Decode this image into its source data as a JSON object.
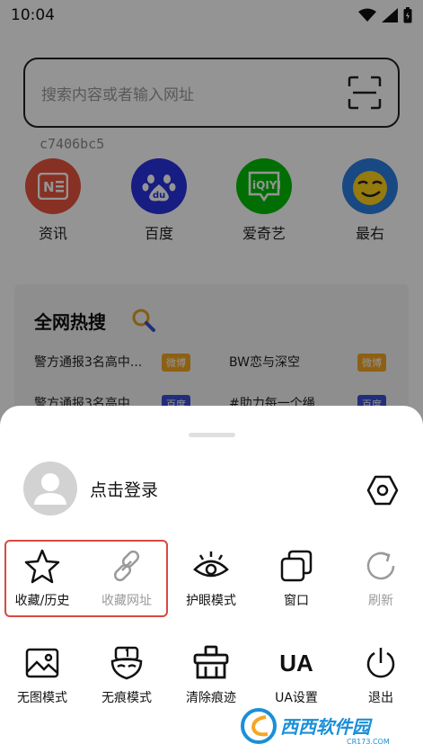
{
  "status_bar": {
    "time": "10:04"
  },
  "search": {
    "placeholder": "搜索内容或者输入网址"
  },
  "device_id": "c7406bc5",
  "shortcuts": [
    {
      "label": "资讯",
      "icon": "news-icon",
      "color": "#e8533e"
    },
    {
      "label": "百度",
      "icon": "baidu-icon",
      "color": "#2932e1"
    },
    {
      "label": "爱奇艺",
      "icon": "iqiyi-icon",
      "color": "#00be06"
    },
    {
      "label": "最右",
      "icon": "zuiyou-icon",
      "color": "#ffcc00"
    }
  ],
  "hot_search": {
    "title": "全网热搜",
    "items": [
      {
        "text": "警方通报3名高中...",
        "tag": "微博",
        "tag_color": "#f5a623"
      },
      {
        "text": "BW恋与深空",
        "tag": "微博",
        "tag_color": "#f5a623"
      },
      {
        "text": "警方通报3名高中...",
        "tag": "百度",
        "tag_color": "#3c4fd6"
      },
      {
        "text": "#助力每一个绳",
        "tag": "百度",
        "tag_color": "#3c4fd6"
      }
    ]
  },
  "sheet": {
    "login_label": "点击登录",
    "menu_row1": [
      {
        "label": "收藏/历史",
        "icon": "star-icon",
        "muted": false
      },
      {
        "label": "收藏网址",
        "icon": "link-icon",
        "muted": true
      },
      {
        "label": "护眼模式",
        "icon": "eye-icon",
        "muted": false
      },
      {
        "label": "窗口",
        "icon": "windows-icon",
        "muted": false
      },
      {
        "label": "刷新",
        "icon": "refresh-icon",
        "muted": true
      }
    ],
    "menu_row2": [
      {
        "label": "无图模式",
        "icon": "image-icon",
        "muted": false
      },
      {
        "label": "无痕模式",
        "icon": "mask-icon",
        "muted": false
      },
      {
        "label": "清除痕迹",
        "icon": "clean-icon",
        "muted": false
      },
      {
        "label": "UA设置",
        "icon": "ua-icon",
        "muted": false
      },
      {
        "label": "退出",
        "icon": "power-icon",
        "muted": false
      }
    ],
    "ua_glyph": "UA"
  },
  "colors": {
    "highlight": "#d9493f",
    "overlay": "rgba(0,0,0,0.42)"
  }
}
